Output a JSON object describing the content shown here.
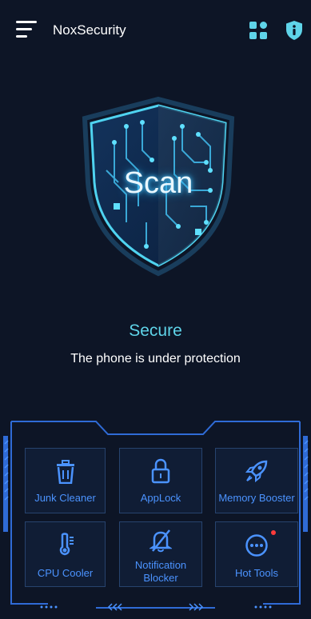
{
  "header": {
    "title": "NoxSecurity",
    "menu_icon": "hamburger-menu-icon",
    "apps_icon": "apps-grid-icon",
    "info_icon": "info-shield-icon"
  },
  "scan": {
    "label": "Scan",
    "icon": "circuit-shield-icon"
  },
  "status": {
    "title": "Secure",
    "subtitle": "The phone is under protection"
  },
  "tools": [
    {
      "label": "Junk Cleaner",
      "icon": "trash-icon"
    },
    {
      "label": "AppLock",
      "icon": "lock-icon"
    },
    {
      "label": "Memory Booster",
      "icon": "rocket-icon"
    },
    {
      "label": "CPU Cooler",
      "icon": "thermometer-icon"
    },
    {
      "label_line1": "Notification",
      "label_line2": "Blocker",
      "icon": "bell-off-icon"
    },
    {
      "label": "Hot Tools",
      "icon": "more-dots-icon",
      "has_badge": true
    }
  ],
  "colors": {
    "background": "#0d1526",
    "accent_cyan": "#5fd4e9",
    "accent_blue": "#4b93ff",
    "badge_red": "#ff3b3b"
  }
}
